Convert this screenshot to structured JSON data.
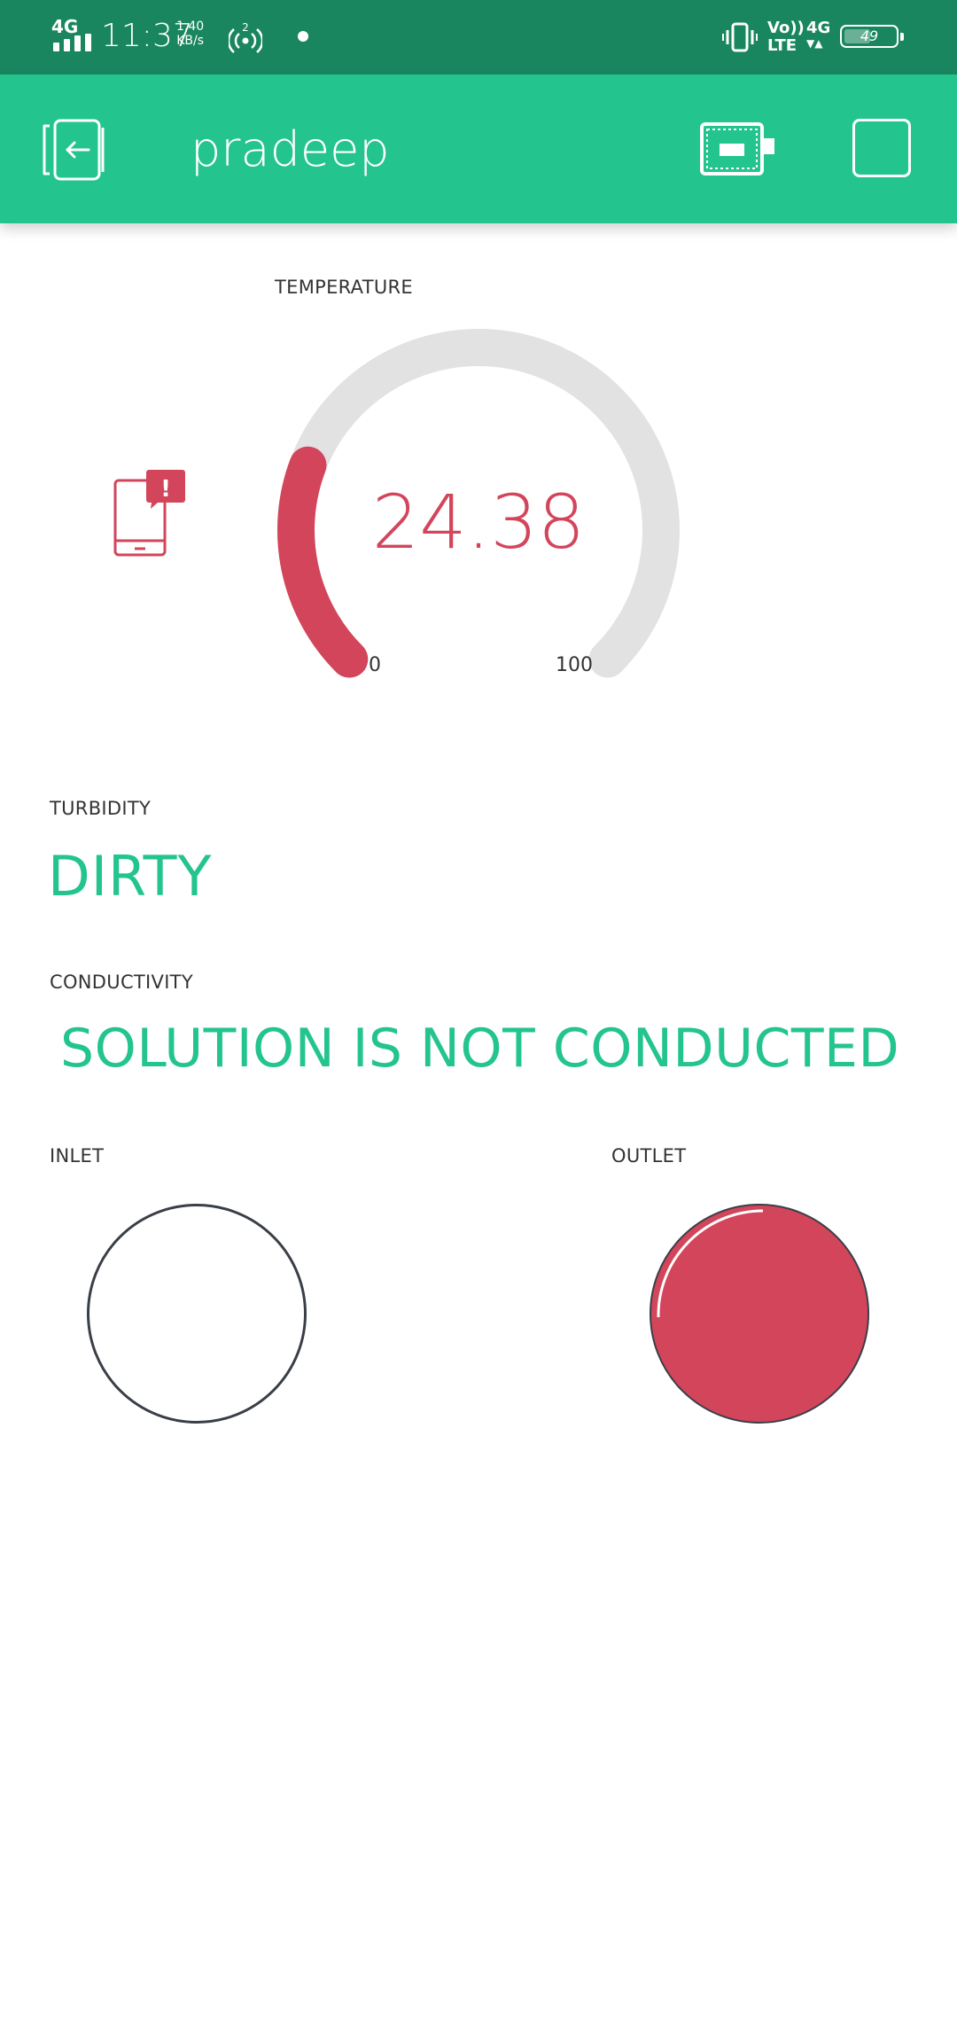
{
  "status_bar": {
    "network_left": "4G",
    "time": "11:37",
    "speed_value": "1.40",
    "speed_unit": "KB/s",
    "hotspot_count": "2",
    "volte_line1": "Vo))",
    "volte_line2": "LTE",
    "network_right": "4G",
    "battery": "49",
    "battery_level_percent": 49,
    "icons": [
      "signal-icon",
      "hotspot-icon",
      "notification-dot-icon",
      "vibrate-icon",
      "battery-icon"
    ]
  },
  "app_bar": {
    "title": "pradeep",
    "icons": [
      "back-icon",
      "device-icon",
      "square-icon"
    ]
  },
  "temperature": {
    "label": "TEMPERATURE",
    "value": "24.38",
    "min": "0",
    "max": "100",
    "fraction": 0.2438,
    "notification_icon": "phone-alert-icon",
    "badge": "!"
  },
  "turbidity": {
    "label": "TURBIDITY",
    "value": "DIRTY"
  },
  "conductivity": {
    "label": "CONDUCTIVITY",
    "value": "SOLUTION IS NOT CONDUCTED"
  },
  "leds": {
    "inlet": {
      "label": "INLET",
      "state": "off"
    },
    "outlet": {
      "label": "OUTLET",
      "state": "on"
    }
  },
  "colors": {
    "status_bar": "#1a8660",
    "app_bar": "#23c48e",
    "accent_green": "#23c48e",
    "accent_red": "#d3455b",
    "gauge_track": "#e1e2e1"
  }
}
